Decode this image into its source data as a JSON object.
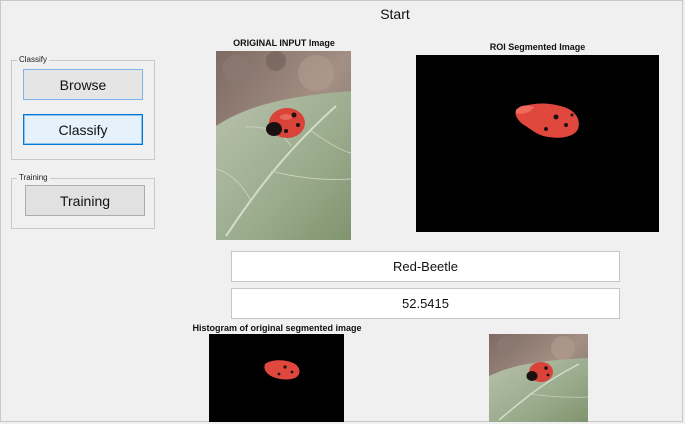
{
  "window": {
    "title": "Start"
  },
  "classify_panel": {
    "legend": "Classify",
    "browse_label": "Browse",
    "classify_label": "Classify"
  },
  "training_panel": {
    "legend": "Training",
    "training_label": "Training"
  },
  "figures": {
    "original_title": "ORIGINAL INPUT Image",
    "roi_title": "ROI Segmented Image",
    "histogram_title": "Histogram of original segmented image"
  },
  "results": {
    "class_label": "Red-Beetle",
    "score": "52.5415"
  },
  "colors": {
    "beetle_red": "#e0483e",
    "leaf_green": "#9aab8c",
    "background_black": "#000000"
  }
}
